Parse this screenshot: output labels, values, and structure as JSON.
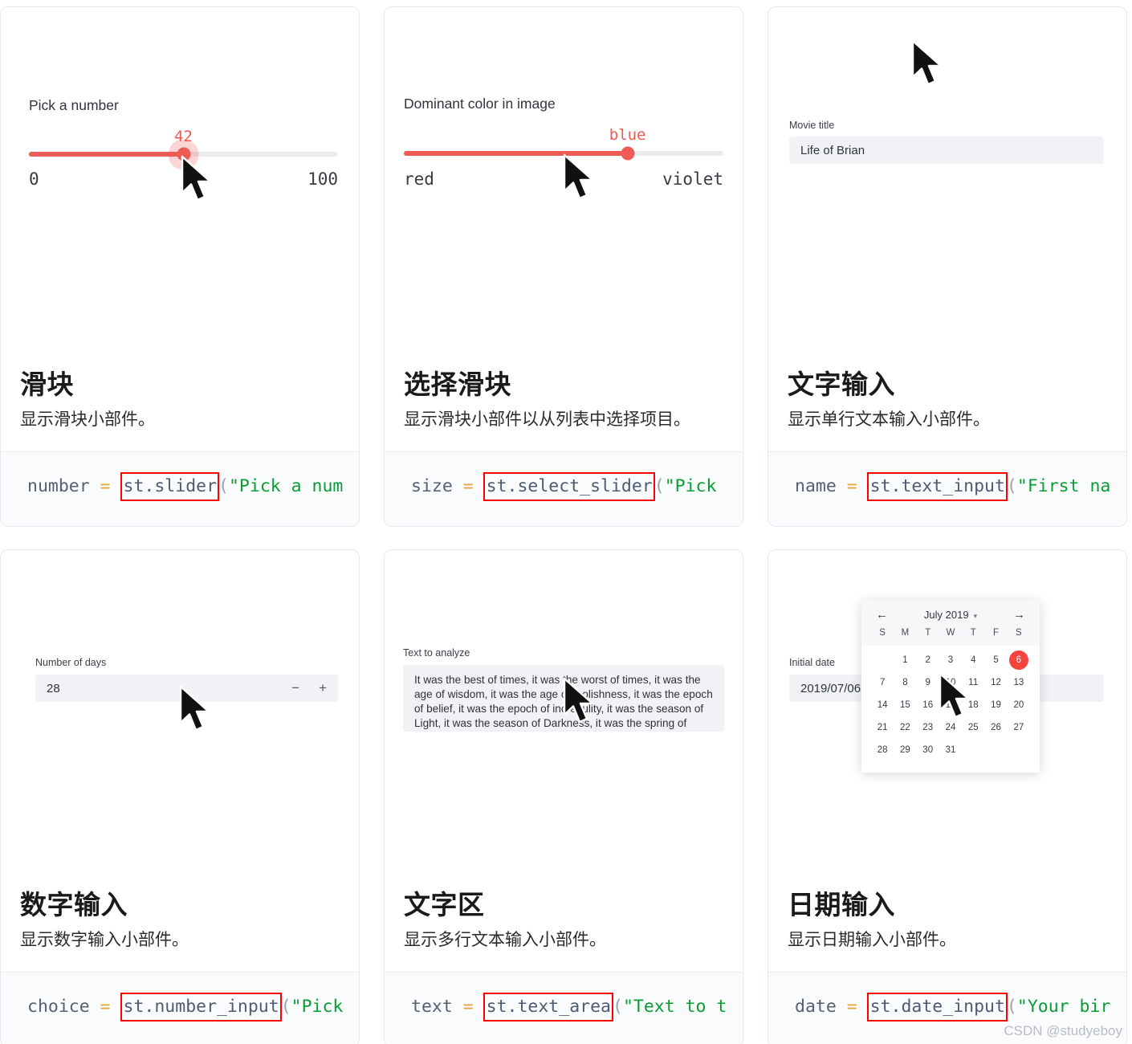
{
  "watermark": "CSDN @studyeboy",
  "cards": [
    {
      "title": "滑块",
      "desc": "显示滑块小部件。",
      "widget": "slider",
      "slider": {
        "label": "Pick a number",
        "value": "42",
        "min_label": "0",
        "max_label": "100",
        "fill_percent": 50
      },
      "code": {
        "var": "number",
        "eq": "=",
        "call": "st.slider",
        "tail_paren": "(",
        "tail_str": "\"Pick a num"
      }
    },
    {
      "title": "选择滑块",
      "desc": "显示滑块小部件以从列表中选择项目。",
      "widget": "select_slider",
      "slider": {
        "label": "Dominant color in image",
        "value": "blue",
        "min_label": "red",
        "max_label": "violet",
        "fill_percent": 70
      },
      "code": {
        "var": "size",
        "eq": "=",
        "call": "st.select_slider",
        "tail_paren": "(",
        "tail_str": "\"Pick"
      }
    },
    {
      "title": "文字输入",
      "desc": "显示单行文本输入小部件。",
      "widget": "text_input",
      "text_input": {
        "label": "Movie title",
        "value": "Life of Brian"
      },
      "code": {
        "var": "name",
        "eq": "=",
        "call": "st.text_input",
        "tail_paren": "(",
        "tail_str": "\"First na"
      }
    },
    {
      "title": "数字输入",
      "desc": "显示数字输入小部件。",
      "widget": "number_input",
      "number_input": {
        "label": "Number of days",
        "value": "28",
        "decrement": "−",
        "increment": "+"
      },
      "code": {
        "var": "choice",
        "eq": "=",
        "call": "st.number_input",
        "tail_paren": "(",
        "tail_str": "\"Pick"
      }
    },
    {
      "title": "文字区",
      "desc": "显示多行文本输入小部件。",
      "widget": "text_area",
      "text_area": {
        "label": "Text to analyze",
        "value": "It was the best of times, it was the worst of times, it was the age of wisdom, it was the age of foolishness, it was the epoch of belief, it was the epoch of incredulity, it was the season of Light, it was the season of Darkness, it was the spring of hope, it was the winter of despair, (...)"
      },
      "code": {
        "var": "text",
        "eq": "=",
        "call": "st.text_area",
        "tail_paren": "(",
        "tail_str": "\"Text to t"
      }
    },
    {
      "title": "日期输入",
      "desc": "显示日期输入小部件。",
      "widget": "date_input",
      "date_input": {
        "label": "Initial date",
        "value": "2019/07/06",
        "calendar": {
          "month_year": "July 2019",
          "prev_arrow": "←",
          "next_arrow": "→",
          "caret": "▾",
          "dow": [
            "S",
            "M",
            "T",
            "W",
            "T",
            "F",
            "S"
          ],
          "weeks": [
            [
              "",
              "1",
              "2",
              "3",
              "4",
              "5",
              "6"
            ],
            [
              "7",
              "8",
              "9",
              "10",
              "11",
              "12",
              "13"
            ],
            [
              "14",
              "15",
              "16",
              "17",
              "18",
              "19",
              "20"
            ],
            [
              "21",
              "22",
              "23",
              "24",
              "25",
              "26",
              "27"
            ],
            [
              "28",
              "29",
              "30",
              "31",
              "",
              "",
              ""
            ]
          ],
          "selected_day": "6"
        }
      },
      "code": {
        "var": "date",
        "eq": "=",
        "call": "st.date_input",
        "tail_paren": "(",
        "tail_str": "\"Your bir"
      }
    }
  ],
  "colors": {
    "accent_red": "#ec5c55",
    "selected_day": "#f5433e",
    "highlight_box": "#ff0000",
    "code_string": "#0a9d34",
    "input_bg": "#f0f2f6"
  }
}
